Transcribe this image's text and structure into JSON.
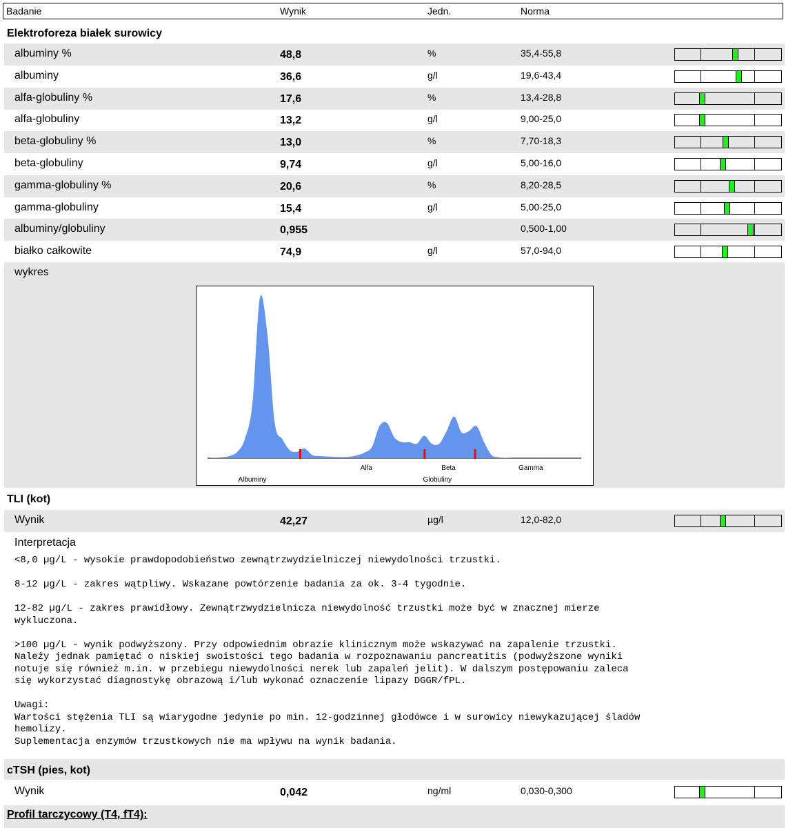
{
  "header": {
    "col_test": "Badanie",
    "col_result": "Wynik",
    "col_unit": "Jedn.",
    "col_norm": "Norma"
  },
  "electrophoresis": {
    "title": "Elektroforeza białek surowicy",
    "rows": [
      {
        "name": "albuminy %",
        "value": "48,8",
        "unit": "%",
        "norm": "35,4-55,8",
        "marker": 0.565,
        "shaded": true
      },
      {
        "name": "albuminy",
        "value": "36,6",
        "unit": "g/l",
        "norm": "19,6-43,4",
        "marker": 0.595,
        "shaded": false
      },
      {
        "name": "alfa-globuliny %",
        "value": "17,6",
        "unit": "%",
        "norm": "13,4-28,8",
        "marker": 0.25,
        "shaded": true
      },
      {
        "name": "alfa-globuliny",
        "value": "13,2",
        "unit": "g/l",
        "norm": "9,00-25,0",
        "marker": 0.25,
        "shaded": false
      },
      {
        "name": "beta-globuliny %",
        "value": "13,0",
        "unit": "%",
        "norm": "7,70-18,3",
        "marker": 0.475,
        "shaded": true
      },
      {
        "name": "beta-globuliny",
        "value": "9,74",
        "unit": "g/l",
        "norm": "5,00-16,0",
        "marker": 0.445,
        "shaded": false
      },
      {
        "name": "gamma-globuliny %",
        "value": "20,6",
        "unit": "%",
        "norm": "8,20-28,5",
        "marker": 0.53,
        "shaded": true
      },
      {
        "name": "gamma-globuliny",
        "value": "15,4",
        "unit": "g/l",
        "norm": "5,00-25,0",
        "marker": 0.49,
        "shaded": false
      },
      {
        "name": "albuminy/globuliny",
        "value": "0,955",
        "unit": "",
        "norm": "0,500-1,00",
        "marker": 0.71,
        "shaded": true
      },
      {
        "name": "białko całkowite",
        "value": "74,9",
        "unit": "g/l",
        "norm": "57,0-94,0",
        "marker": 0.47,
        "shaded": false
      }
    ],
    "chart_label": "wykres"
  },
  "chart_data": {
    "type": "area",
    "title": "",
    "color": "#6495ed",
    "divider_color": "#e01010",
    "x_labels": [
      "Alfa",
      "Beta",
      "Gamma"
    ],
    "group_labels": [
      "Albuminy",
      "Globuliny"
    ],
    "x": [
      0,
      2,
      4,
      6,
      8,
      10,
      12,
      14,
      16,
      18,
      20,
      22,
      24,
      26,
      28,
      30,
      32,
      34,
      36,
      38,
      40,
      42,
      44,
      46,
      48,
      50,
      52,
      54,
      56,
      58,
      60,
      62,
      64,
      66,
      68,
      70,
      72,
      74,
      76,
      78,
      80,
      82,
      84,
      86,
      88,
      90,
      92,
      94,
      96,
      98,
      100
    ],
    "values": [
      0,
      0.2,
      0.6,
      1.4,
      4,
      12,
      34,
      100,
      78,
      22,
      12,
      5,
      4,
      6,
      2,
      1.3,
      1,
      0.8,
      0.7,
      0.9,
      1.8,
      3.5,
      7,
      20,
      22,
      13,
      10,
      10,
      9,
      14,
      9,
      9,
      17,
      26,
      16,
      17,
      20,
      10,
      2,
      0.5,
      0.2,
      0,
      0,
      0,
      0,
      0,
      0,
      0,
      0,
      0,
      0
    ],
    "dividers": [
      24.7,
      58,
      71.5
    ]
  },
  "tli": {
    "title": "TLI (kot)",
    "row": {
      "name": "Wynik",
      "value": "42,27",
      "unit": "µg/l",
      "norm": "12,0-82,0",
      "marker": 0.45,
      "shaded": true
    },
    "interp_label": "Interpretacja",
    "interp_text": "<8,0 µg/L - wysokie prawdopodobieństwo zewnątrzwydzielniczej niewydolności trzustki.\n\n8-12 µg/L - zakres wątpliwy. Wskazane powtórzenie badania za ok. 3-4 tygodnie.\n\n12-82 µg/L - zakres prawidłowy. Zewnątrzwydzielnicza niewydolność trzustki może być w znacznej mierze\nwykluczona.\n\n>100 µg/L - wynik podwyższony. Przy odpowiednim obrazie klinicznym może wskazywać na zapalenie trzustki.\nNależy jednak pamiętać o niskiej swoistości tego badania w rozpoznawaniu pancreatitis (podwyższone wyniki\nnotuje się również m.in. w przebiegu niewydolności nerek lub zapaleń jelit). W dalszym postępowaniu zaleca\nsię wykorzystać diagnostykę obrazową i/lub wykonać oznaczenie lipazy DGGR/fPL.\n\nUwagi:\nWartości stężenia TLI są wiarygodne jedynie po min. 12-godzinnej głodówce i w surowicy niewykazującej śladów\nhemolizy.\nSuplementacja enzymów trzustkowych nie ma wpływu na wynik badania."
  },
  "ctsh": {
    "title": "cTSH (pies, kot)",
    "row": {
      "name": "Wynik",
      "value": "0,042",
      "unit": "ng/ml",
      "norm": "0,030-0,300",
      "marker": 0.255,
      "shaded": false
    }
  },
  "profil": {
    "title": "Profil tarczycowy (T4, fT4):"
  }
}
